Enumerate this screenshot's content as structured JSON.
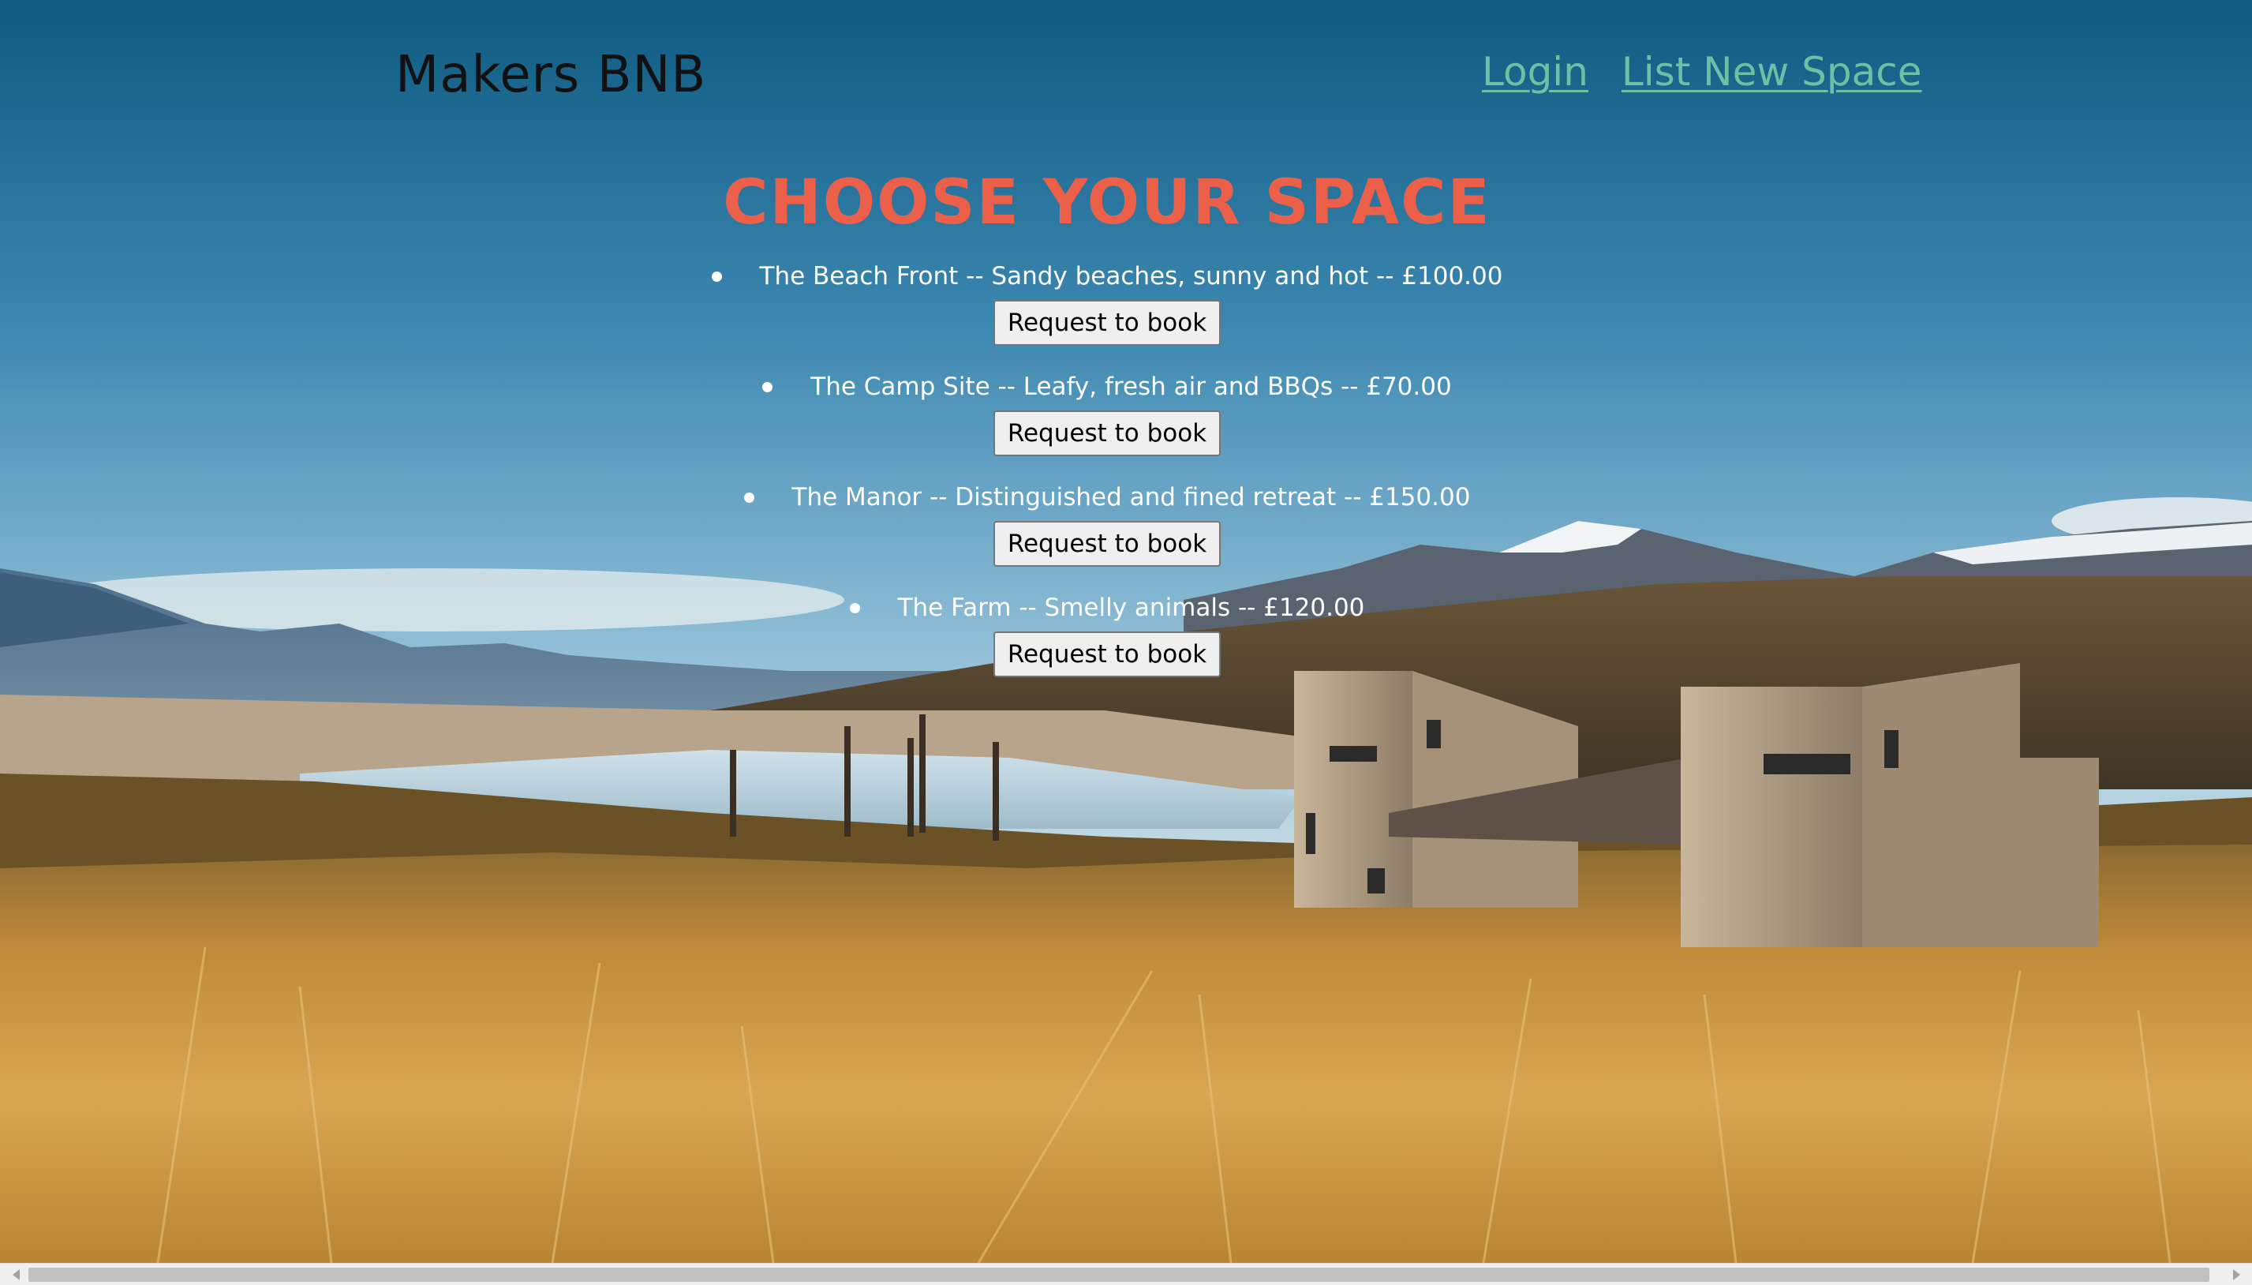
{
  "header": {
    "brand": "Makers BNB",
    "nav": {
      "login": "Login",
      "list_new_space": "List New Space"
    }
  },
  "main": {
    "title": "CHOOSE YOUR SPACE",
    "spaces": [
      {
        "text": "The Beach Front -- Sandy beaches, sunny and hot -- £100.00",
        "button": "Request to book"
      },
      {
        "text": "The Camp Site -- Leafy, fresh air and BBQs -- £70.00",
        "button": "Request to book"
      },
      {
        "text": "The Manor -- Distinguished and fined retreat -- £150.00",
        "button": "Request to book"
      },
      {
        "text": "The Farm -- Smelly animals -- £120.00",
        "button": "Request to book"
      }
    ]
  },
  "colors": {
    "title": "#ec5f48",
    "nav_link": "#6ec0a4",
    "brand": "#111111",
    "list_text": "#ffffff"
  },
  "background": {
    "image_icon": "landscape-photo"
  }
}
